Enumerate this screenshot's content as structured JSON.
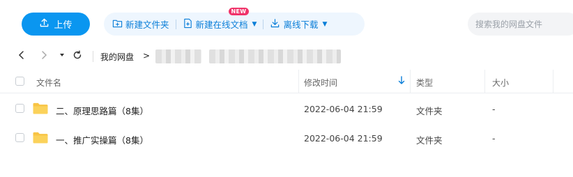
{
  "toolbar": {
    "upload_label": "上传",
    "new_folder_label": "新建文件夹",
    "new_online_doc_label": "新建在线文档",
    "new_badge": "NEW",
    "offline_download_label": "离线下载",
    "search_placeholder": "搜索我的网盘文件"
  },
  "breadcrumb": {
    "root": "我的网盘",
    "arrow": ">"
  },
  "table": {
    "headers": {
      "name": "文件名",
      "modified": "修改时间",
      "type": "类型",
      "size": "大小"
    },
    "sorted_by": "modified",
    "rows": [
      {
        "name": "二、原理思路篇（8集）",
        "modified": "2022-06-04 21:59",
        "type": "文件夹",
        "size": "-"
      },
      {
        "name": "一、推广实操篇（8集）",
        "modified": "2022-06-04 21:59",
        "type": "文件夹",
        "size": "-"
      }
    ]
  },
  "colors": {
    "accent": "#0a96f0",
    "action_bg": "#eef6fe",
    "badge": "#f0346a",
    "folder": "#f8c445"
  },
  "icons": {
    "upload": "upload-icon",
    "new_folder": "new-folder-icon",
    "new_doc": "new-doc-icon",
    "download": "download-icon",
    "back": "back-icon",
    "forward": "forward-icon",
    "dropdown": "dropdown-icon",
    "refresh": "refresh-icon",
    "folder": "folder-icon",
    "sort": "sort-down-icon"
  }
}
